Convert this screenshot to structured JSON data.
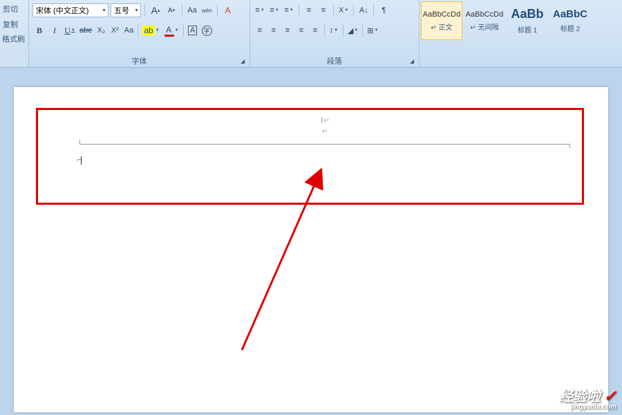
{
  "clipboard": {
    "cut": "剪切",
    "copy": "复制",
    "format_painter": "格式刷"
  },
  "font": {
    "section_label": "字体",
    "name": "宋体 (中文正文)",
    "size": "五号",
    "grow_icon": "A",
    "shrink_icon": "A",
    "change_case_icon": "Aa",
    "phonetic_icon": "wén",
    "clear_format_icon": "A",
    "bold": "B",
    "italic": "I",
    "underline": "U",
    "strike": "abe",
    "subscript": "X₂",
    "superscript": "X²",
    "text_effects": "Aa",
    "highlight": "ab",
    "highlight_color": "#ffff00",
    "font_color_letter": "A",
    "font_color": "#e00000",
    "char_border": "A",
    "circle_char": "字"
  },
  "paragraph": {
    "section_label": "段落",
    "bullets": "≡",
    "numbering": "≡",
    "multilevel": "≡",
    "decrease_indent": "≡",
    "increase_indent": "≡",
    "asian_layout": "X",
    "sort": "A↓",
    "show_marks": "¶",
    "align_left": "≡",
    "align_center": "≡",
    "align_right": "≡",
    "justify": "≡",
    "distribute": "≡",
    "line_spacing": "↕",
    "shading": "◢",
    "borders": "⊞"
  },
  "styles": {
    "normal": {
      "preview": "AaBbCcDd",
      "label": "正文"
    },
    "no_spacing": {
      "preview": "AaBbCcDd",
      "label": "无间隔"
    },
    "heading1": {
      "preview": "AaBb",
      "label": "标题 1"
    },
    "heading2": {
      "preview": "AaBbC",
      "label": "标题 2"
    }
  },
  "document": {
    "page_number": "1",
    "pilcrow": "↵"
  },
  "watermark": {
    "main": "经验啦",
    "check": "✓",
    "sub": "jingyanla.com"
  }
}
